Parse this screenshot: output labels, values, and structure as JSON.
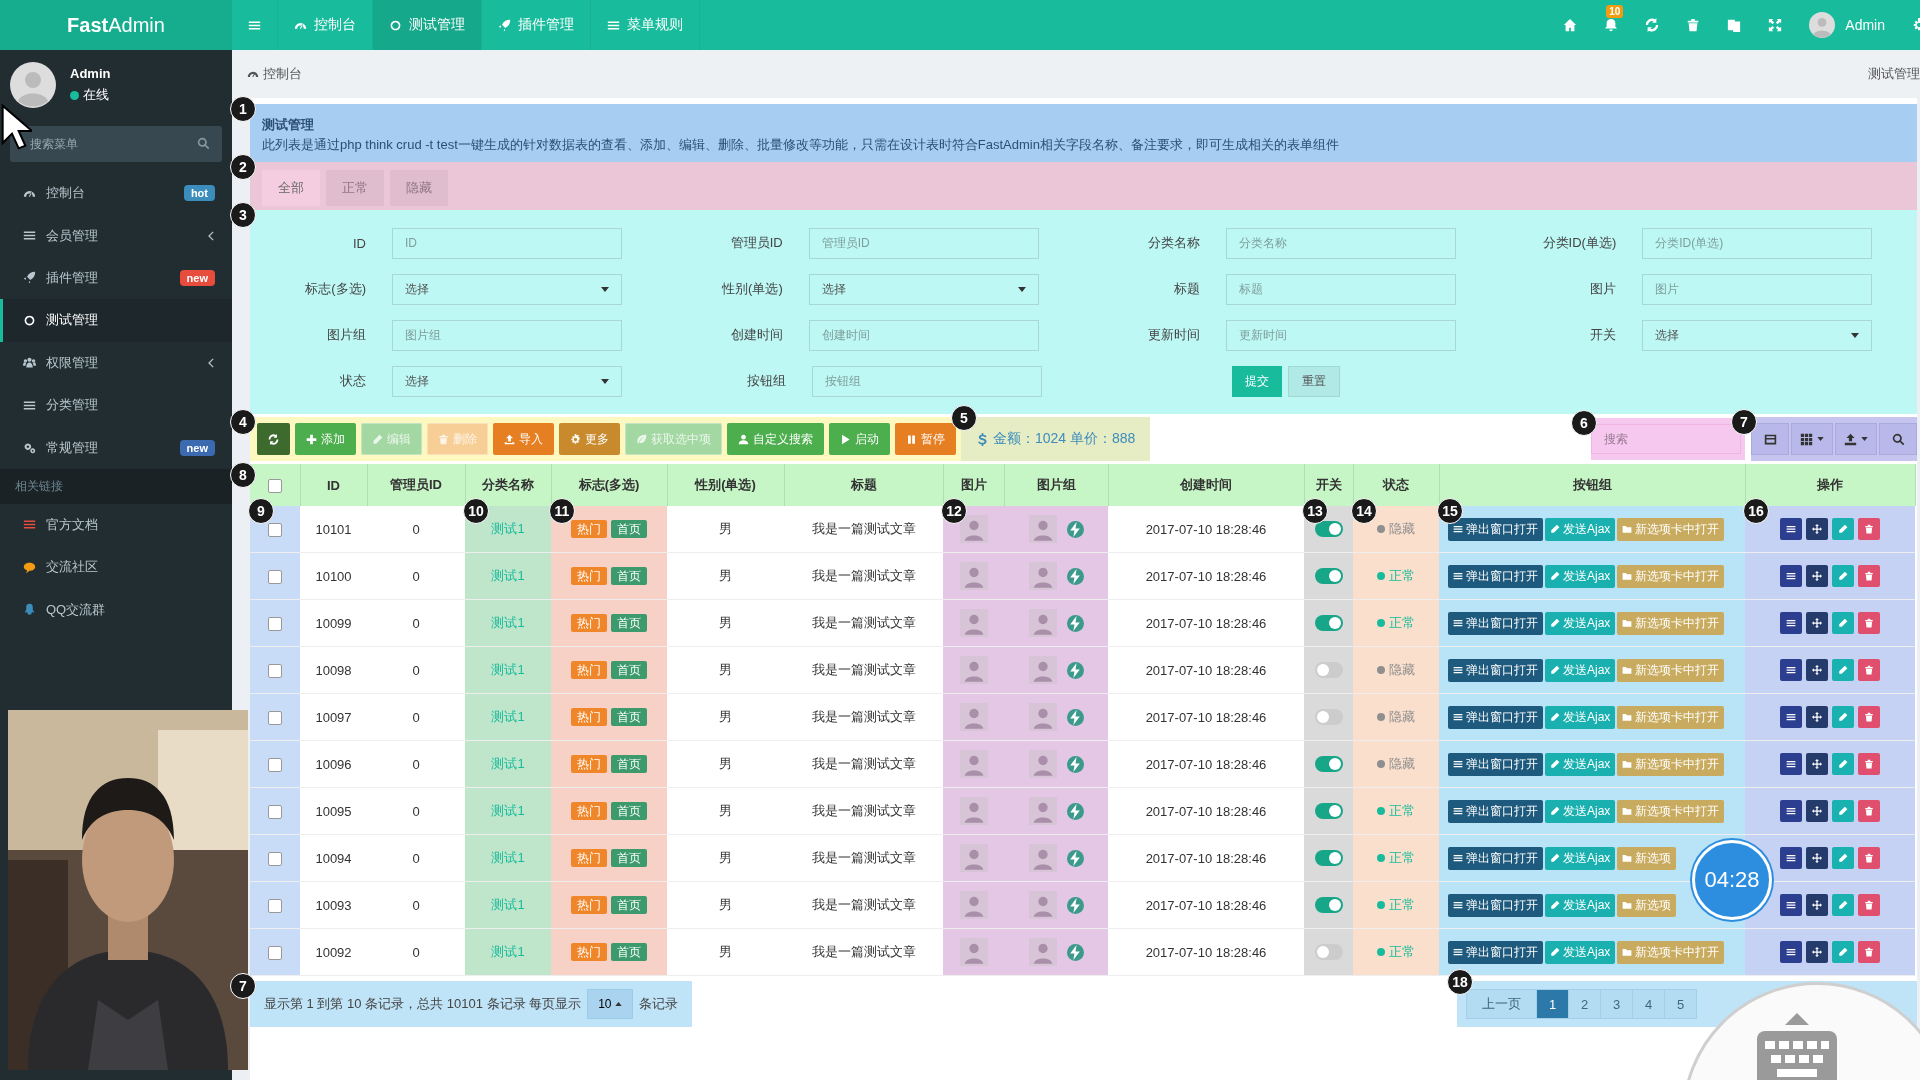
{
  "topbar": {
    "logo": "**Fast**Admin",
    "nav": [
      {
        "label": "控制台",
        "selected": false
      },
      {
        "label": "测试管理",
        "selected": true
      },
      {
        "label": "插件管理",
        "selected": false
      },
      {
        "label": "菜单规则",
        "selected": false
      }
    ],
    "notification_count": "10",
    "user": "Admin"
  },
  "sidebar": {
    "user": {
      "name": "Admin",
      "status": "在线"
    },
    "search": {
      "placeholder": "搜索菜单"
    },
    "items": [
      {
        "label": "控制台",
        "selected": false,
        "badge": {
          "text": "hot",
          "color": "#3c8dbc"
        }
      },
      {
        "label": "会员管理",
        "selected": false,
        "has_children": true
      },
      {
        "label": "插件管理",
        "selected": false,
        "badge": {
          "text": "new",
          "color": "#e74c3c"
        }
      },
      {
        "label": "测试管理",
        "selected": true
      },
      {
        "label": "权限管理",
        "selected": false,
        "has_children": true
      },
      {
        "label": "分类管理",
        "selected": false
      },
      {
        "label": "常规管理",
        "selected": false,
        "badge": {
          "text": "new",
          "color": "#3c6ab0"
        }
      }
    ],
    "section": "相关链接",
    "links": [
      {
        "label": "官方文档",
        "color": "#e74c3c"
      },
      {
        "label": "交流社区",
        "color": "#f39c12"
      },
      {
        "label": "QQ交流群",
        "color": "#3c8dbc"
      }
    ]
  },
  "breadcrumb": {
    "left": "控制台",
    "right": "测试管理"
  },
  "alert": {
    "marker": "1",
    "title": "测试管理",
    "text": "此列表是通过php think crud -t test一键生成的针对数据表的查看、添加、编辑、删除、批量修改等功能，只需在设计表时符合FastAdmin相关字段名称、备注要求，即可生成相关的表单组件"
  },
  "tabs": {
    "marker": "2",
    "items": [
      {
        "label": "全部",
        "selected": true
      },
      {
        "label": "正常",
        "selected": false
      },
      {
        "label": "隐藏",
        "selected": false
      }
    ]
  },
  "filter_form": {
    "marker": "3",
    "fields": [
      {
        "label": "ID",
        "kind": "text",
        "placeholder": "ID"
      },
      {
        "label": "管理员ID",
        "kind": "text",
        "placeholder": "管理员ID"
      },
      {
        "label": "分类名称",
        "kind": "text",
        "placeholder": "分类名称"
      },
      {
        "label": "分类ID(单选)",
        "kind": "text",
        "placeholder": "分类ID(单选)"
      },
      {
        "label": "标志(多选)",
        "kind": "select",
        "value": "选择"
      },
      {
        "label": "性别(单选)",
        "kind": "select",
        "value": "选择"
      },
      {
        "label": "标题",
        "kind": "text",
        "placeholder": "标题"
      },
      {
        "label": "图片",
        "kind": "text",
        "placeholder": "图片"
      },
      {
        "label": "图片组",
        "kind": "text",
        "placeholder": "图片组"
      },
      {
        "label": "创建时间",
        "kind": "text",
        "placeholder": "创建时间"
      },
      {
        "label": "更新时间",
        "kind": "text",
        "placeholder": "更新时间"
      },
      {
        "label": "开关",
        "kind": "select",
        "value": "选择"
      },
      {
        "label": "状态",
        "kind": "select",
        "value": "选择"
      },
      {
        "label": "按钮组",
        "kind": "text",
        "placeholder": "按钮组"
      }
    ],
    "submit": "提交",
    "reset": "重置"
  },
  "toolbar": {
    "marker": "4",
    "buttons": [
      {
        "color": "#3d6b2e",
        "disabled": false
      },
      {
        "label": "添加",
        "color": "#4cae4c",
        "disabled": false
      },
      {
        "label": "编辑",
        "color": "#a3d8a3",
        "disabled": true
      },
      {
        "label": "删除",
        "color": "#f7cf96",
        "disabled": true
      },
      {
        "label": "导入",
        "color": "#e67e22",
        "disabled": false
      },
      {
        "label": "更多",
        "color": "#c98a2e",
        "disabled": false
      },
      {
        "label": "获取选中项",
        "color": "#a3d8a3",
        "disabled": true
      },
      {
        "label": "自定义搜索",
        "color": "#4cae4c",
        "disabled": false
      },
      {
        "label": "启动",
        "color": "#4cae4c",
        "disabled": false
      },
      {
        "label": "暂停",
        "color": "#e67e22",
        "disabled": false
      }
    ],
    "amount": {
      "marker": "5",
      "text": "金额：1024 单价：888"
    },
    "search": {
      "marker": "6",
      "placeholder": "搜索"
    },
    "tools_marker": "7"
  },
  "table": {
    "marker": "8",
    "select_all_checked": false,
    "columns": [
      {
        "marker": "9"
      },
      {
        "label": "ID"
      },
      {
        "label": "管理员ID"
      },
      {
        "label": "分类名称",
        "marker": "10"
      },
      {
        "label": "标志(多选)",
        "marker": "11"
      },
      {
        "label": "性别(单选)"
      },
      {
        "label": "标题"
      },
      {
        "label": "图片",
        "marker": "12"
      },
      {
        "label": "图片组"
      },
      {
        "label": "创建时间"
      },
      {
        "label": "开关",
        "marker": "13"
      },
      {
        "label": "状态",
        "marker": "14"
      },
      {
        "label": "按钮组",
        "marker": "15"
      },
      {
        "label": "操作",
        "marker": "16"
      }
    ],
    "rows": [
      {
        "checked": false,
        "id": "10101",
        "admin_id": "0",
        "category": "测试1",
        "flags": [
          "热门",
          "首页"
        ],
        "gender": "男",
        "title": "我是一篇测试文章",
        "created": "2017-07-10 18:28:46",
        "on": true,
        "status": {
          "label": "隐藏",
          "kind": "hidden"
        },
        "buttons": [
          "弹出窗口打开",
          "发送Ajax",
          "新选项卡中打开"
        ]
      },
      {
        "checked": false,
        "id": "10100",
        "admin_id": "0",
        "category": "测试1",
        "flags": [
          "热门",
          "首页"
        ],
        "gender": "男",
        "title": "我是一篇测试文章",
        "created": "2017-07-10 18:28:46",
        "on": true,
        "status": {
          "label": "正常",
          "kind": "normal"
        },
        "buttons": [
          "弹出窗口打开",
          "发送Ajax",
          "新选项卡中打开"
        ]
      },
      {
        "checked": false,
        "id": "10099",
        "admin_id": "0",
        "category": "测试1",
        "flags": [
          "热门",
          "首页"
        ],
        "gender": "男",
        "title": "我是一篇测试文章",
        "created": "2017-07-10 18:28:46",
        "on": true,
        "status": {
          "label": "正常",
          "kind": "normal"
        },
        "buttons": [
          "弹出窗口打开",
          "发送Ajax",
          "新选项卡中打开"
        ]
      },
      {
        "checked": false,
        "id": "10098",
        "admin_id": "0",
        "category": "测试1",
        "flags": [
          "热门",
          "首页"
        ],
        "gender": "男",
        "title": "我是一篇测试文章",
        "created": "2017-07-10 18:28:46",
        "on": false,
        "status": {
          "label": "隐藏",
          "kind": "hidden"
        },
        "buttons": [
          "弹出窗口打开",
          "发送Ajax",
          "新选项卡中打开"
        ]
      },
      {
        "checked": false,
        "id": "10097",
        "admin_id": "0",
        "category": "测试1",
        "flags": [
          "热门",
          "首页"
        ],
        "gender": "男",
        "title": "我是一篇测试文章",
        "created": "2017-07-10 18:28:46",
        "on": false,
        "status": {
          "label": "隐藏",
          "kind": "hidden"
        },
        "buttons": [
          "弹出窗口打开",
          "发送Ajax",
          "新选项卡中打开"
        ]
      },
      {
        "checked": false,
        "id": "10096",
        "admin_id": "0",
        "category": "测试1",
        "flags": [
          "热门",
          "首页"
        ],
        "gender": "男",
        "title": "我是一篇测试文章",
        "created": "2017-07-10 18:28:46",
        "on": true,
        "status": {
          "label": "隐藏",
          "kind": "hidden"
        },
        "buttons": [
          "弹出窗口打开",
          "发送Ajax",
          "新选项卡中打开"
        ]
      },
      {
        "checked": false,
        "id": "10095",
        "admin_id": "0",
        "category": "测试1",
        "flags": [
          "热门",
          "首页"
        ],
        "gender": "男",
        "title": "我是一篇测试文章",
        "created": "2017-07-10 18:28:46",
        "on": true,
        "status": {
          "label": "正常",
          "kind": "normal"
        },
        "buttons": [
          "弹出窗口打开",
          "发送Ajax",
          "新选项卡中打开"
        ]
      },
      {
        "checked": false,
        "id": "10094",
        "admin_id": "0",
        "category": "测试1",
        "flags": [
          "热门",
          "首页"
        ],
        "gender": "男",
        "title": "我是一篇测试文章",
        "created": "2017-07-10 18:28:46",
        "on": true,
        "status": {
          "label": "正常",
          "kind": "normal"
        },
        "buttons": [
          "弹出窗口打开",
          "发送Ajax",
          "新选项"
        ]
      },
      {
        "checked": false,
        "id": "10093",
        "admin_id": "0",
        "category": "测试1",
        "flags": [
          "热门",
          "首页"
        ],
        "gender": "男",
        "title": "我是一篇测试文章",
        "created": "2017-07-10 18:28:46",
        "on": true,
        "status": {
          "label": "正常",
          "kind": "normal"
        },
        "buttons": [
          "弹出窗口打开",
          "发送Ajax",
          "新选项"
        ]
      },
      {
        "checked": false,
        "id": "10092",
        "admin_id": "0",
        "category": "测试1",
        "flags": [
          "热门",
          "首页"
        ],
        "gender": "男",
        "title": "我是一篇测试文章",
        "created": "2017-07-10 18:28:46",
        "on": false,
        "status": {
          "label": "正常",
          "kind": "normal"
        },
        "buttons": [
          "弹出窗口打开",
          "发送Ajax",
          "新选项卡中打开"
        ]
      }
    ]
  },
  "pagination": {
    "marker": "7",
    "summary": "显示第 1 到第 10 条记录，总共 10101 条记录 每页显示",
    "page_size": "10",
    "suffix": "条记录",
    "pages_marker": "18",
    "prev": "上一页",
    "pages": [
      {
        "label": "1",
        "selected": true
      },
      {
        "label": "2",
        "selected": false
      },
      {
        "label": "3",
        "selected": false
      },
      {
        "label": "4",
        "selected": false
      },
      {
        "label": "5",
        "selected": false
      }
    ]
  },
  "timer": "04:28"
}
